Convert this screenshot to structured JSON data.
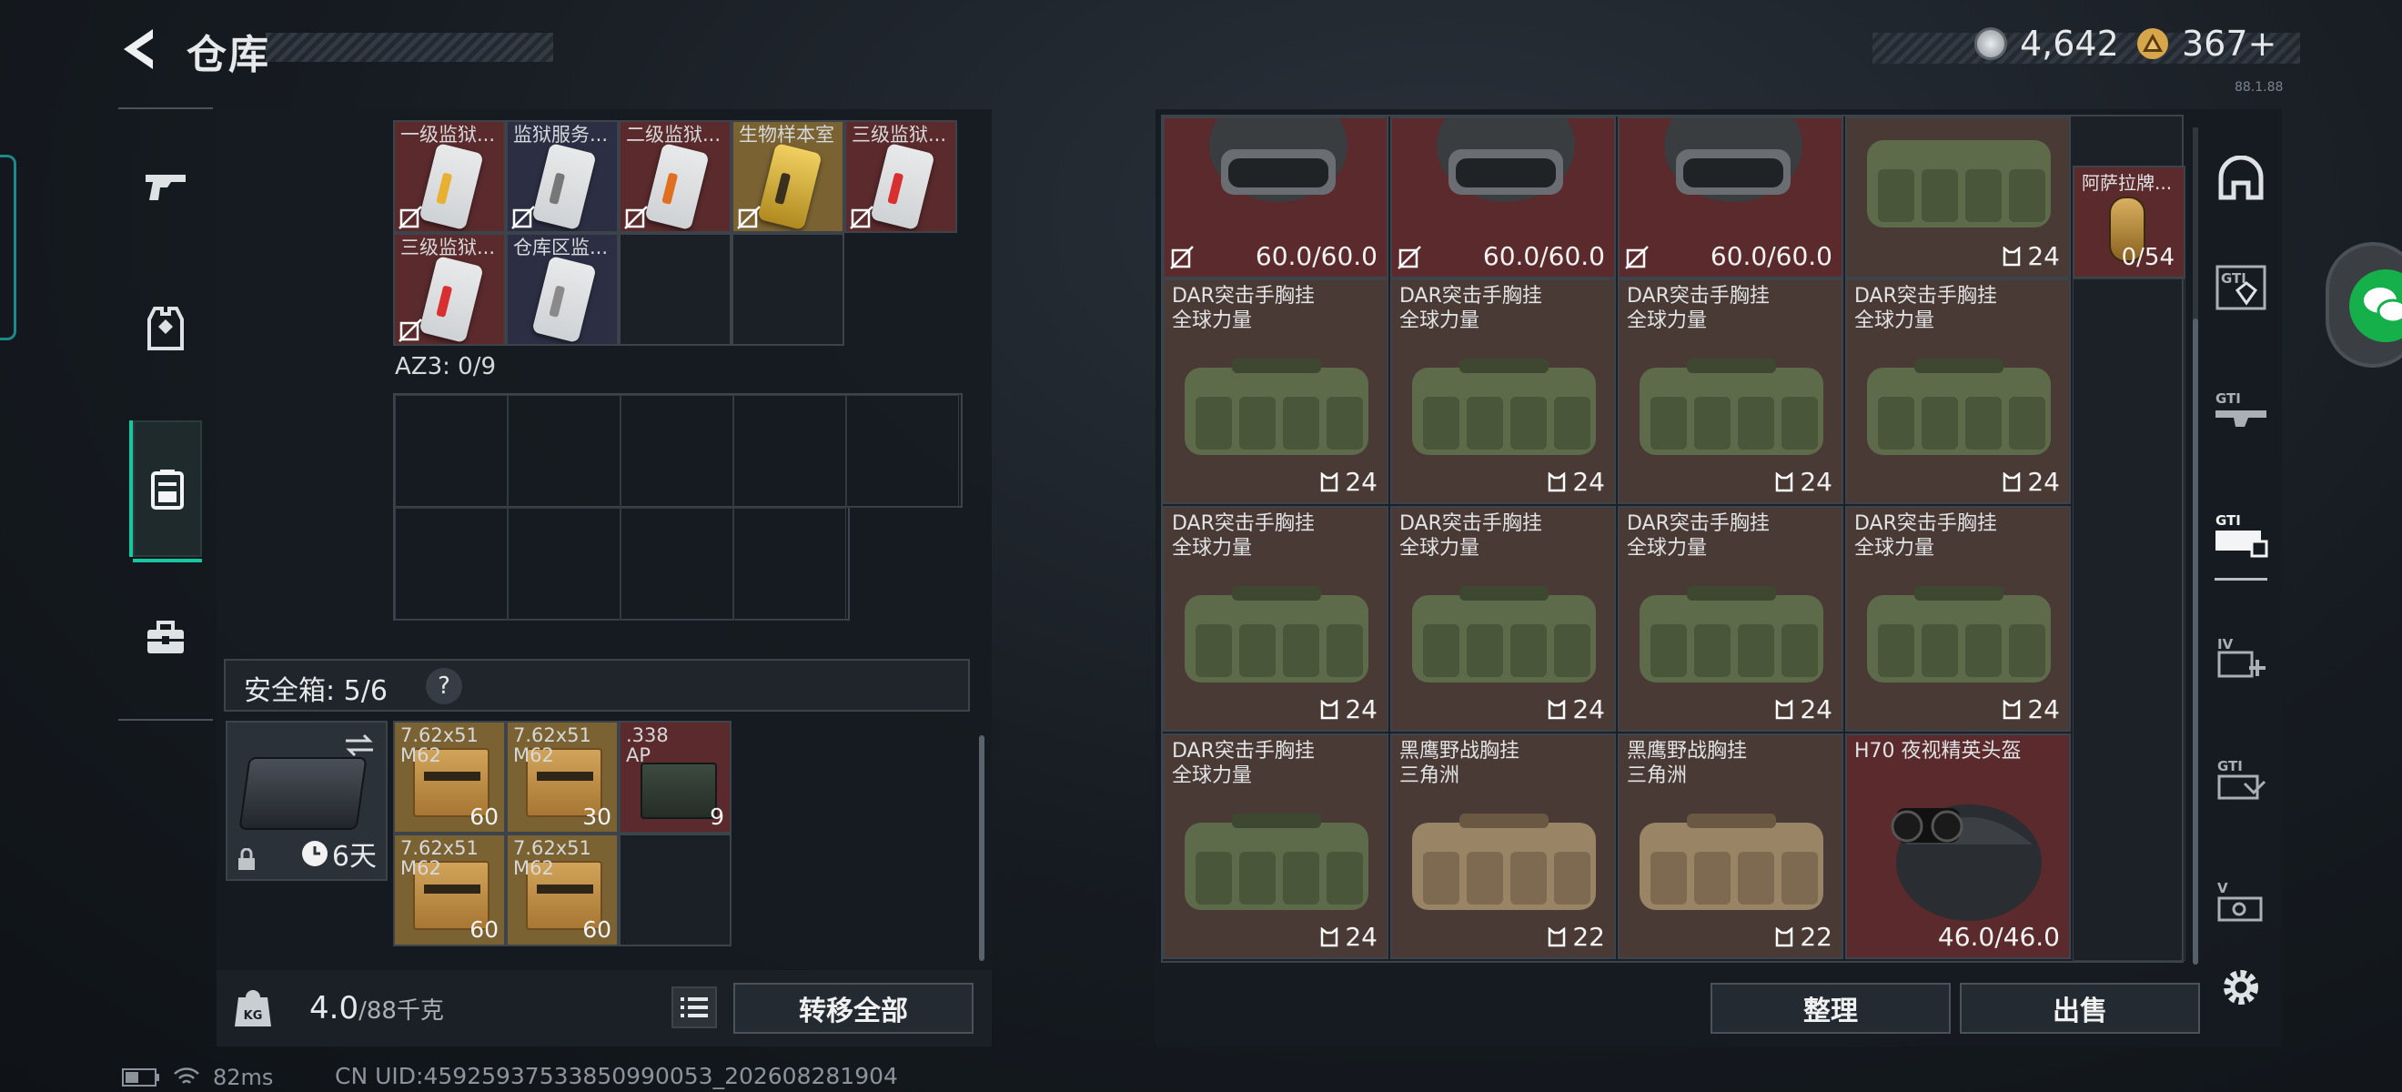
{
  "header": {
    "title": "仓库",
    "back_icon": "back-arrow-icon"
  },
  "currency": [
    {
      "icon": "silver-coin-icon",
      "value": "4,642",
      "color": "#b9bec4"
    },
    {
      "icon": "gold-triangle-icon",
      "value": "367+",
      "color": "#d8a64a"
    }
  ],
  "left_rail": [
    {
      "icon": "gun-icon",
      "active": false
    },
    {
      "icon": "vest-icon",
      "active": false
    },
    {
      "icon": "backpack-icon",
      "active": true
    },
    {
      "icon": "briefcase-icon",
      "active": false
    }
  ],
  "keycards": [
    {
      "name": "一级监狱...",
      "color": "red"
    },
    {
      "name": "监狱服务...",
      "color": "dark"
    },
    {
      "name": "二级监狱...",
      "color": "red"
    },
    {
      "name": "生物样本室",
      "color": "gold"
    },
    {
      "name": "三级监狱...",
      "color": "red"
    },
    {
      "name": "三级监狱...",
      "color": "red"
    },
    {
      "name": "仓库区监...",
      "color": "dark"
    }
  ],
  "az3": {
    "label": "AZ3: 0/9"
  },
  "safe": {
    "label": "安全箱: 5/6",
    "help": "?",
    "days": "6天"
  },
  "safe_items": [
    {
      "name1": "7.62x51",
      "name2": "M62",
      "count": "60",
      "type": "ammo"
    },
    {
      "name1": "7.62x51",
      "name2": "M62",
      "count": "30",
      "type": "ammo"
    },
    {
      "name1": ".338",
      "name2": "AP",
      "count": "9",
      "type": "box"
    },
    {
      "name1": "7.62x51",
      "name2": "M62",
      "count": "60",
      "type": "ammo"
    },
    {
      "name1": "7.62x51",
      "name2": "M62",
      "count": "60",
      "type": "ammo"
    }
  ],
  "weight": {
    "current": "4.0",
    "max": "/88千克"
  },
  "buttons": {
    "transfer_all": "转移全部",
    "organize": "整理",
    "sell": "出售"
  },
  "status": {
    "ping": "82ms",
    "uid": "CN UID:45925937533850990053_202608281904",
    "version": "88.1.88"
  },
  "right_top": [
    {
      "type": "helmet",
      "value": "60.0/60.0"
    },
    {
      "type": "helmet",
      "value": "60.0/60.0"
    },
    {
      "type": "helmet",
      "value": "60.0/60.0"
    },
    {
      "type": "bag",
      "count": "24"
    }
  ],
  "token": {
    "name": "阿萨拉牌...",
    "count": "0/54"
  },
  "right_items": [
    {
      "name1": "DAR突击手胸挂",
      "name2": "全球力量",
      "count": "24",
      "color": "green"
    },
    {
      "name1": "DAR突击手胸挂",
      "name2": "全球力量",
      "count": "24",
      "color": "green"
    },
    {
      "name1": "DAR突击手胸挂",
      "name2": "全球力量",
      "count": "24",
      "color": "green"
    },
    {
      "name1": "DAR突击手胸挂",
      "name2": "全球力量",
      "count": "24",
      "color": "green"
    },
    {
      "name1": "DAR突击手胸挂",
      "name2": "全球力量",
      "count": "24",
      "color": "green"
    },
    {
      "name1": "DAR突击手胸挂",
      "name2": "全球力量",
      "count": "24",
      "color": "green"
    },
    {
      "name1": "DAR突击手胸挂",
      "name2": "全球力量",
      "count": "24",
      "color": "green"
    },
    {
      "name1": "DAR突击手胸挂",
      "name2": "全球力量",
      "count": "24",
      "color": "green"
    },
    {
      "name1": "DAR突击手胸挂",
      "name2": "全球力量",
      "count": "24",
      "color": "green"
    },
    {
      "name1": "黑鹰野战胸挂",
      "name2": "三角洲",
      "count": "22",
      "color": "tan"
    },
    {
      "name1": "黑鹰野战胸挂",
      "name2": "三角洲",
      "count": "22",
      "color": "tan"
    }
  ],
  "nv_helmet": {
    "name": "H70 夜视精英头盔",
    "value": "46.0/46.0"
  },
  "right_rail": [
    {
      "icon": "helmet-slot-icon"
    },
    {
      "icon": "gti-armor-icon"
    },
    {
      "icon": "gti-rifle-icon"
    },
    {
      "icon": "gti-rig-icon",
      "active": true
    },
    {
      "icon": "iv-medical-icon"
    },
    {
      "icon": "gti-gear-icon"
    },
    {
      "icon": "v-gear-icon"
    }
  ]
}
